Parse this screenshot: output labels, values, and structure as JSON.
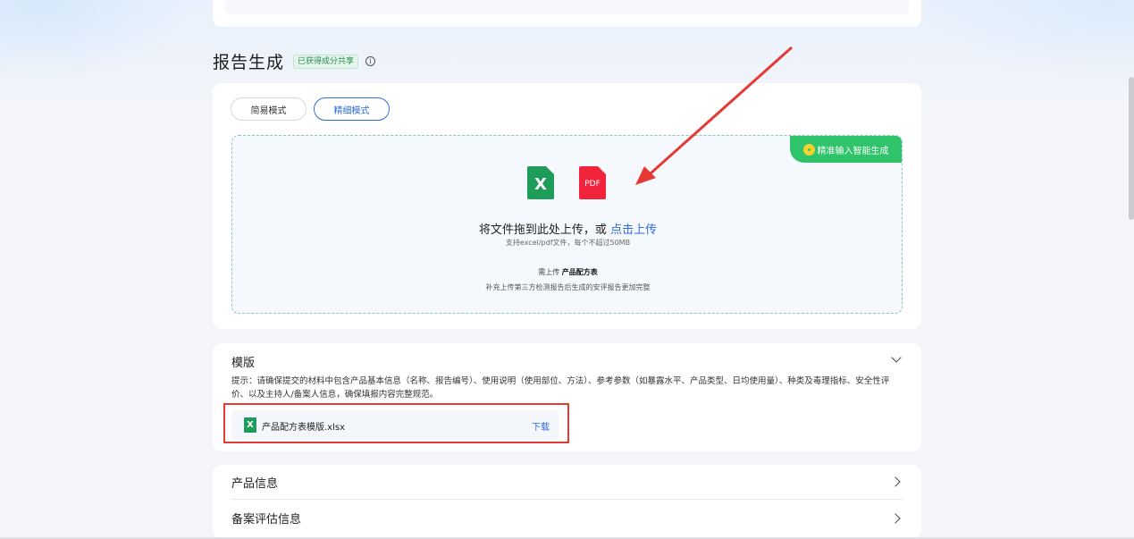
{
  "report": {
    "title": "报告生成",
    "badge": "已获得成分共享",
    "info_icon": "i",
    "modes": [
      {
        "label": "简易模式",
        "active": false
      },
      {
        "label": "精细模式",
        "active": true
      }
    ],
    "ribbon_label": "精准输入智能生成",
    "upload": {
      "excel_glyph": "X",
      "pdf_glyph": "PDF",
      "main_text": "将文件拖到此处上传，或",
      "link_text": "点击上传",
      "sub_text": "支持excel/pdf文件，每个不超过50MB",
      "need_prefix": "需上传",
      "need_item": "产品配方表",
      "hint": "补充上传第三方检测报告后生成的安评报告更加完整"
    }
  },
  "template": {
    "title": "模版",
    "tip": "提示：请确保提交的材料中包含产品基本信息（名称、报告编号）、使用说明（使用部位、方法）、参考参数（如暴露水平、产品类型、日均使用量）、种类及毒理指标、安全性评价、以及主持人/备案人信息，确保填报内容完整规范。",
    "file_glyph": "X",
    "file_name": "产品配方表模版.xlsx",
    "download_label": "下载"
  },
  "sections": [
    {
      "label": "产品信息"
    },
    {
      "label": "备案评估信息"
    }
  ],
  "colors": {
    "accent": "#2f6bdc",
    "ribbon": "#2fc36a",
    "excel": "#1d9c5a",
    "pdf": "#f2243b",
    "annotation": "#e53935"
  }
}
